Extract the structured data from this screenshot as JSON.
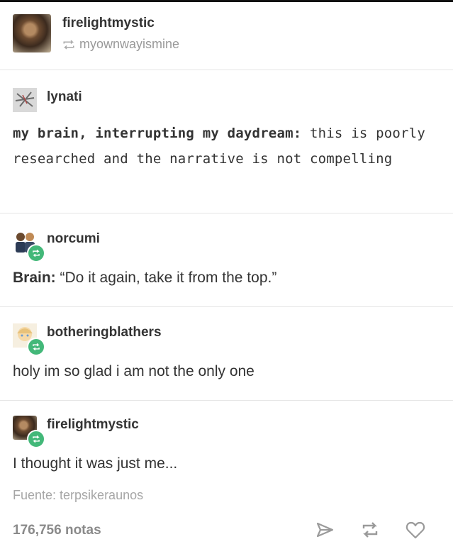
{
  "post": {
    "op_name": "firelightmystic",
    "reblogged_from": "myownwayismine"
  },
  "entries": [
    {
      "username": "lynati",
      "bold_text": "my brain, interrupting my daydream:",
      "text": " this is poorly researched and the narrative is not compelling"
    },
    {
      "username": "norcumi",
      "bold_text": "Brain:",
      "text": " “Do it again, take it from the top.”"
    },
    {
      "username": "botheringblathers",
      "text": "holy im so glad i am not the only one"
    },
    {
      "username": "firelightmystic",
      "text": "I thought it was just me..."
    }
  ],
  "footer": {
    "source": "Fuente: terpsikeraunos",
    "notes": "176,756 notas"
  },
  "icons": {
    "share": "share-icon",
    "reblog": "reblog-icon",
    "like": "heart-icon"
  },
  "colors": {
    "badge": "#43b879",
    "muted": "#a6a6a6"
  }
}
